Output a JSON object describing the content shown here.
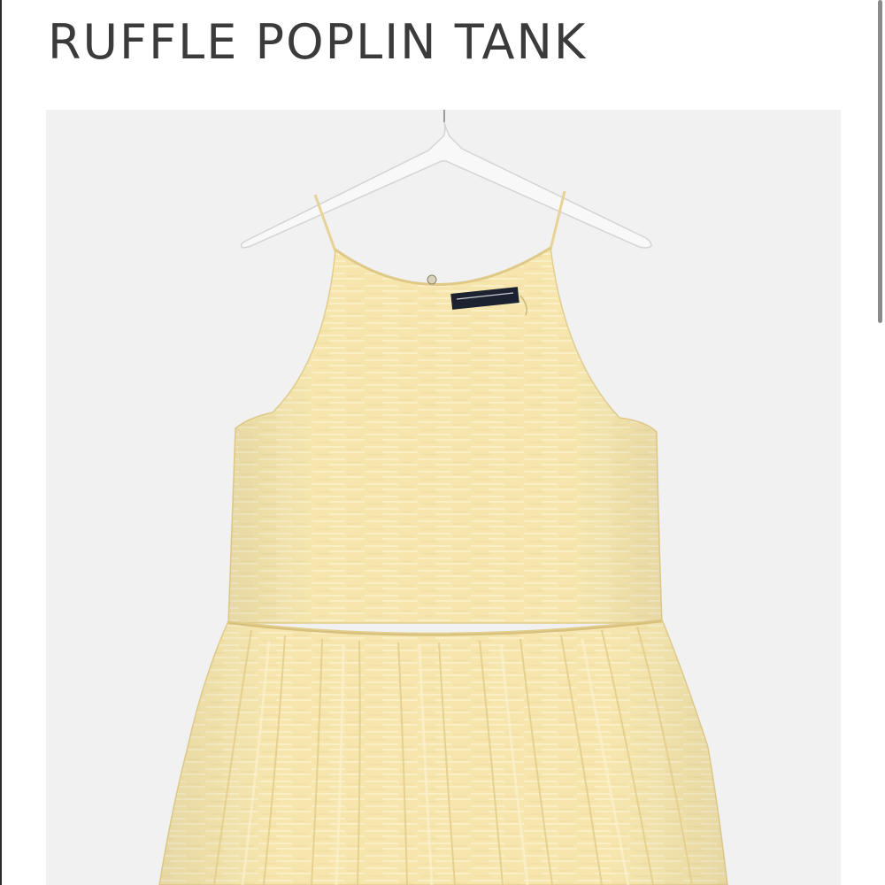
{
  "product": {
    "title": "RUFFLE POPLIN TANK",
    "image": {
      "subject": "yellow-ruffle-tank-on-hanger",
      "background_color": "#f1f1f1",
      "garment_color": "#f6e6ae",
      "hanger_color": "#f7f7f7",
      "label_color": "#1d2230"
    }
  },
  "scroll": {
    "thumb_color": "#8a8a8a"
  }
}
